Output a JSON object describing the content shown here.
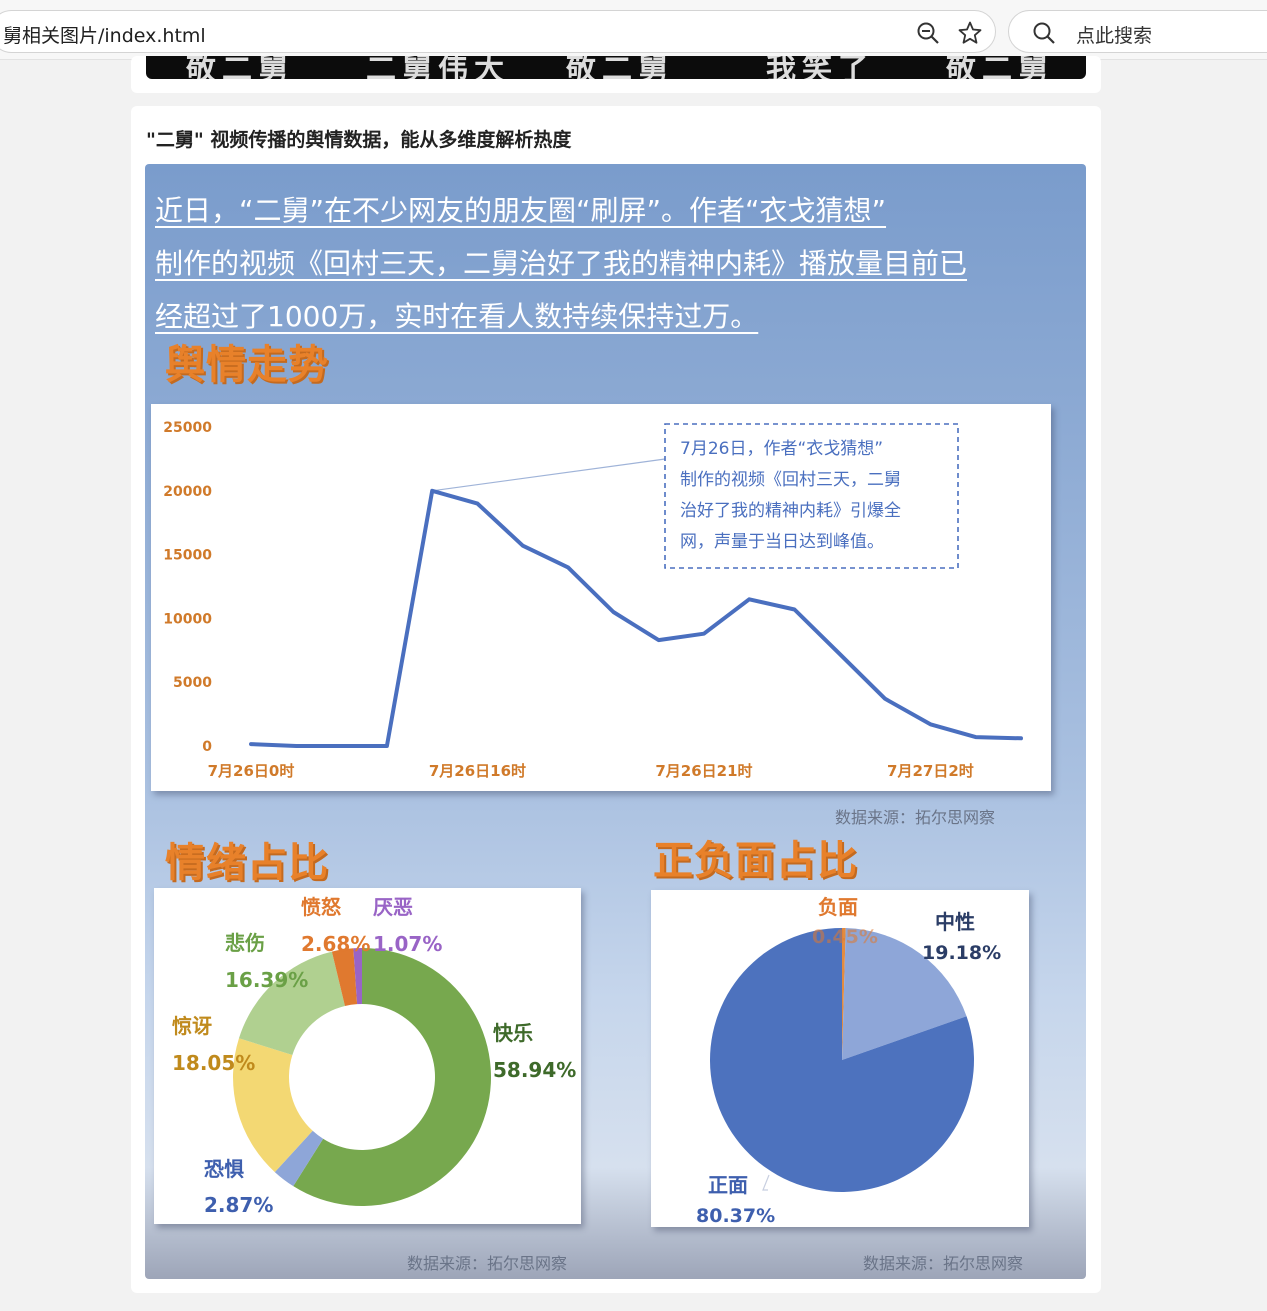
{
  "browser": {
    "url": "舅相关图片/index.html",
    "search_placeholder": "点此搜索",
    "icons": [
      "zoom-icon",
      "star-icon",
      "search-icon"
    ]
  },
  "top_card": {
    "video_caption_fragments": [
      "敬二舅",
      "二舅伟大",
      "敬二舅",
      "我笑了",
      "敬二舅"
    ]
  },
  "article": {
    "title": "\"二舅\" 视频传播的舆情数据，能从多维度解析热度"
  },
  "infographic": {
    "intro_lines": [
      "近日，“二舅”在不少网友的朋友圈“刷屏”。作者“衣戈猜想”",
      "制作的视频《回村三天，二舅治好了我的精神内耗》播放量目前已",
      "经超过了1000万，实时在看人数持续保持过万。"
    ],
    "trend_heading": "舆情走势",
    "emotion_heading": "情绪占比",
    "polarity_heading": "正负面占比",
    "source_trend": "数据来源：拓尔思网察",
    "source_emotion": "数据来源：拓尔思网察",
    "source_polarity": "数据来源：拓尔思网察",
    "annotation_lines": [
      "7月26日，作者“衣戈猜想”",
      "制作的视频《回村三天，二舅",
      "治好了我的精神内耗》引爆全",
      "网，声量于当日达到峰值。"
    ]
  },
  "chart_data": [
    {
      "type": "line",
      "title": "舆情走势",
      "y_ticks": [
        0,
        5000,
        10000,
        15000,
        20000,
        25000
      ],
      "ylim": [
        0,
        25000
      ],
      "x_tick_labels": [
        "7月26日0时",
        "7月26日16时",
        "7月26日21时",
        "7月27日2时"
      ],
      "x_tick_positions": [
        0,
        5,
        10,
        15
      ],
      "series": [
        {
          "color": "#4a6fbf",
          "x": [
            0,
            1,
            2,
            3,
            4,
            5,
            6,
            7,
            8,
            9,
            10,
            11,
            12,
            13,
            14,
            15,
            16,
            17
          ],
          "values": [
            150,
            0,
            0,
            0,
            20000,
            19000,
            15700,
            14000,
            10500,
            8300,
            8800,
            11500,
            10700,
            7200,
            3700,
            1700,
            700,
            600
          ]
        }
      ]
    },
    {
      "type": "pie",
      "subtype": "donut",
      "title": "情绪占比",
      "labels": [
        "快乐",
        "恐惧",
        "惊讶",
        "悲伤",
        "愤怒",
        "厌恶"
      ],
      "values": [
        58.94,
        2.87,
        18.05,
        16.39,
        2.68,
        1.07
      ],
      "value_labels": [
        "58.94%",
        "2.87%",
        "18.05%",
        "16.39%",
        "2.68%",
        "1.07%"
      ],
      "colors": [
        "#77a84e",
        "#8ea6d8",
        "#f3d873",
        "#b0d090",
        "#e0792f",
        "#9964c6"
      ]
    },
    {
      "type": "pie",
      "title": "正负面占比",
      "labels": [
        "负面",
        "中性",
        "正面"
      ],
      "values": [
        0.45,
        19.18,
        80.37
      ],
      "value_labels": [
        "0.45%",
        "19.18%",
        "80.37%"
      ],
      "colors": [
        "#e38b3f",
        "#8ea6d8",
        "#4d72be"
      ]
    }
  ]
}
